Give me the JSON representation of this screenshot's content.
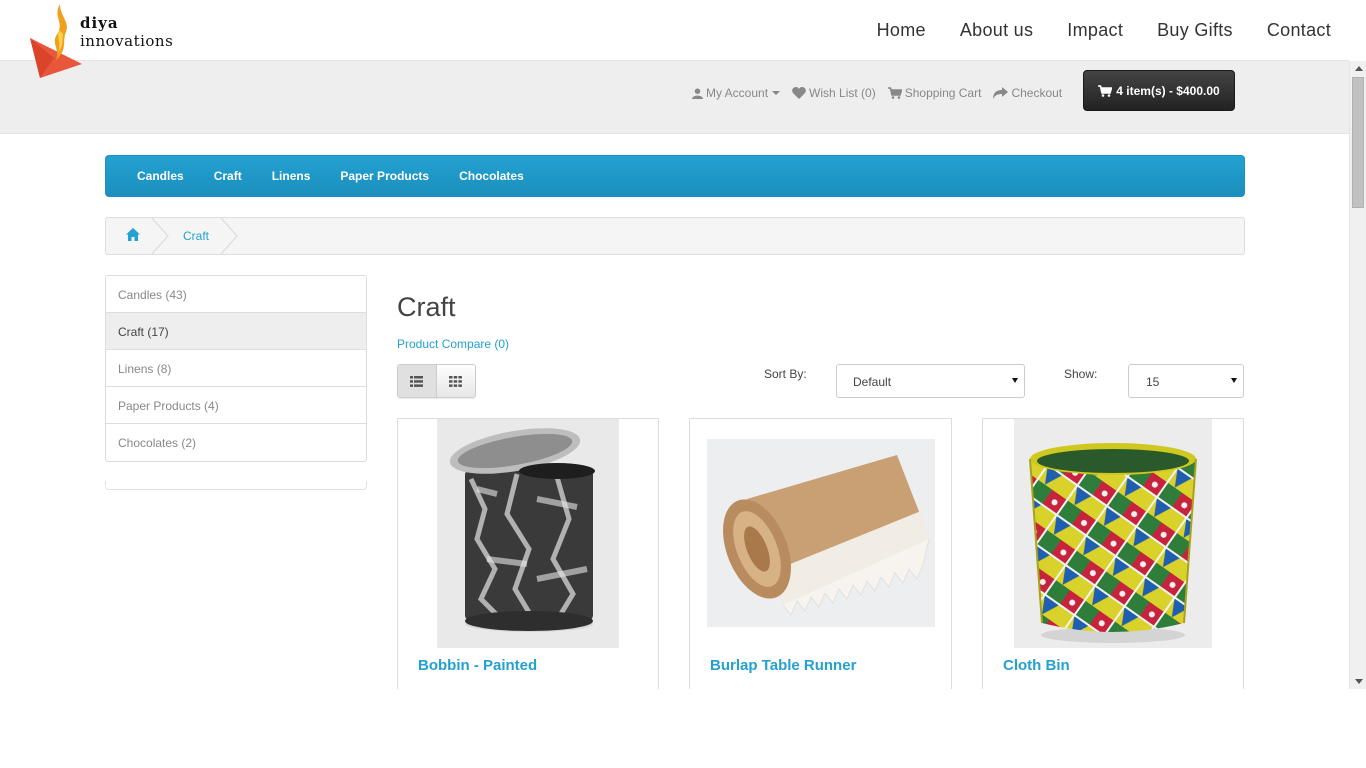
{
  "brand": {
    "line1": "diya",
    "line2": "innovations",
    "flame_color": "#f0a01e",
    "triangle_color": "#e8573a"
  },
  "topnav": [
    "Home",
    "About us",
    "Impact",
    "Buy Gifts",
    "Contact"
  ],
  "account": {
    "my_account": "My Account",
    "wish_list": "Wish List (0)",
    "shopping_cart": "Shopping Cart",
    "checkout": "Checkout",
    "cart_summary": "4 item(s) - $400.00"
  },
  "menu": [
    "Candles",
    "Craft",
    "Linens",
    "Paper Products",
    "Chocolates"
  ],
  "breadcrumb": {
    "current": "Craft"
  },
  "sidebar": [
    {
      "label": "Candles (43)",
      "active": false
    },
    {
      "label": "Craft (17)",
      "active": true
    },
    {
      "label": "Linens (8)",
      "active": false
    },
    {
      "label": "Paper Products (4)",
      "active": false
    },
    {
      "label": "Chocolates (2)",
      "active": false
    }
  ],
  "page": {
    "title": "Craft",
    "compare": "Product Compare (0)",
    "sort_label": "Sort By:",
    "sort_value": "Default",
    "show_label": "Show:",
    "show_value": "15"
  },
  "products": [
    {
      "name": "Bobbin - Painted"
    },
    {
      "name": "Burlap Table Runner"
    },
    {
      "name": "Cloth Bin"
    }
  ],
  "colors": {
    "accent": "#23a1d1",
    "cart_button": "#2b2b2b"
  }
}
